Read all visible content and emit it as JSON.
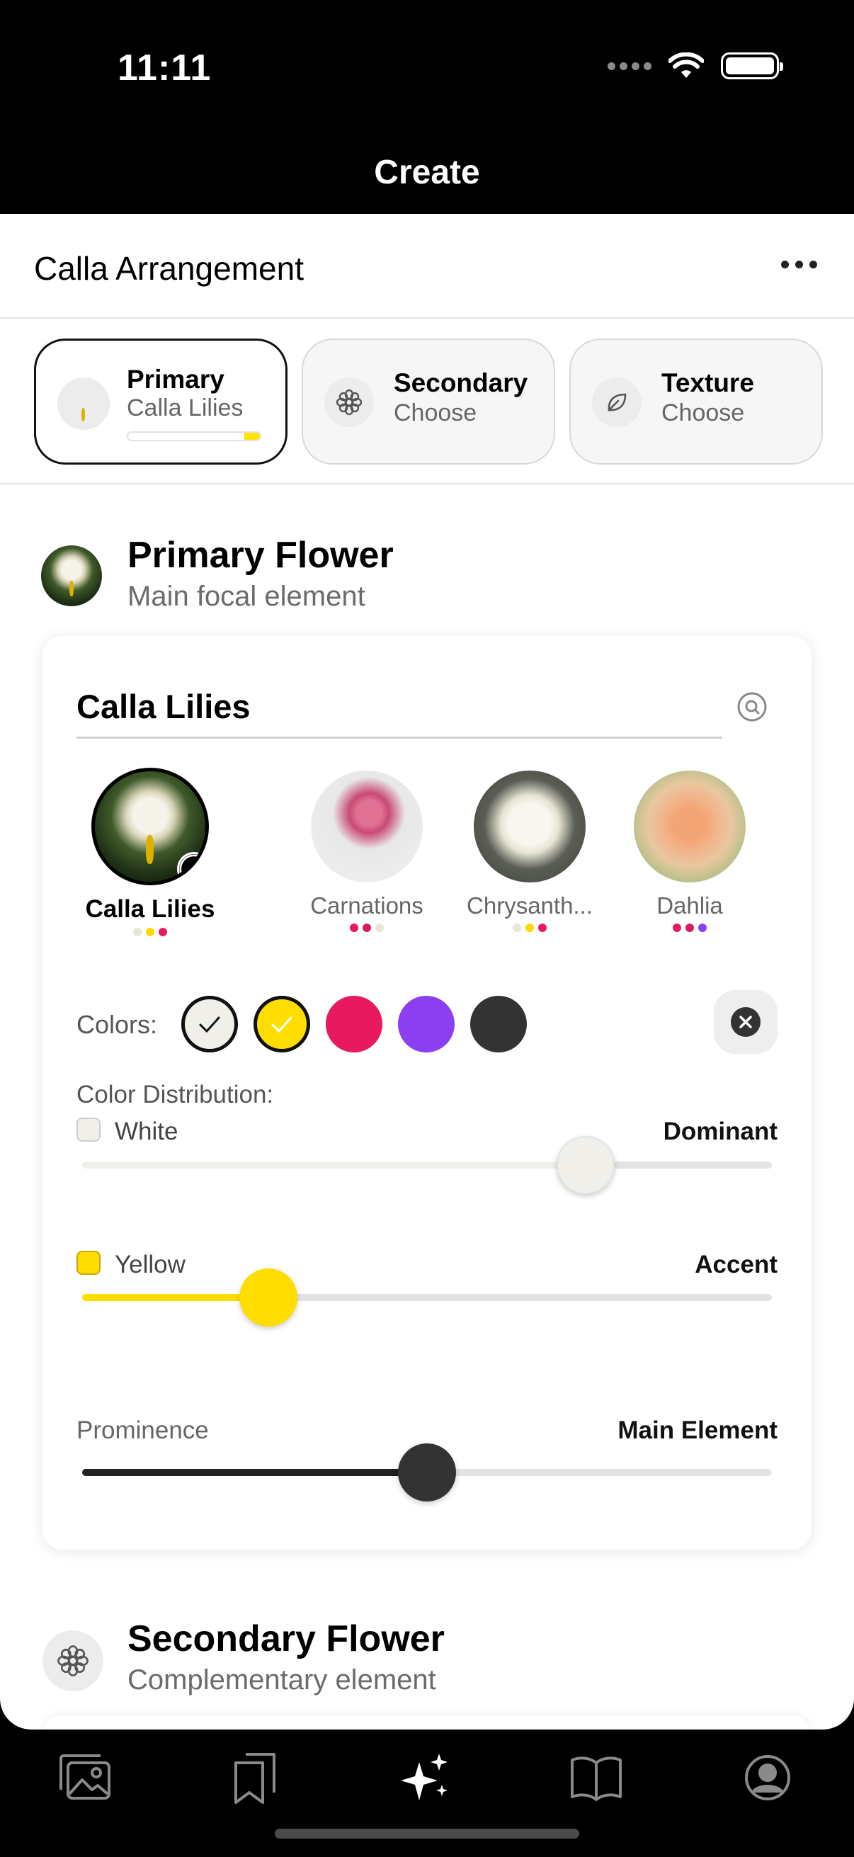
{
  "status_bar": {
    "time": "11:11"
  },
  "nav": {
    "title": "Create"
  },
  "arrangement": {
    "title": "Calla Arrangement"
  },
  "tabs": [
    {
      "label": "Primary",
      "sub": "Calla Lilies",
      "progress": 0.12
    },
    {
      "label": "Secondary",
      "sub": "Choose",
      "icon": "flower-icon"
    },
    {
      "label": "Texture",
      "sub": "Choose",
      "icon": "leaf-icon"
    }
  ],
  "primary_section": {
    "title": "Primary Flower",
    "subtitle": "Main focal element",
    "search_value": "Calla Lilies",
    "flowers": [
      {
        "name": "Calla Lilies",
        "selected": true,
        "dots": [
          "#e8e6d8",
          "#ffd900",
          "#e8195f"
        ]
      },
      {
        "name": "Carnations",
        "dots": [
          "#e8195f",
          "#d81b60",
          "#e8e6d8"
        ]
      },
      {
        "name": "Chrysanth...",
        "dots": [
          "#e8e6d8",
          "#ffd900",
          "#e8195f"
        ]
      },
      {
        "name": "Dahlia",
        "dots": [
          "#e8195f",
          "#d81b60",
          "#8a3ff0"
        ]
      }
    ],
    "colors_label": "Colors:",
    "colors": [
      {
        "name": "white",
        "hex": "#f0efe9",
        "selected": true
      },
      {
        "name": "yellow",
        "hex": "#ffdd00",
        "selected": true
      },
      {
        "name": "pink",
        "hex": "#e8195f"
      },
      {
        "name": "purple",
        "hex": "#8a3ff0"
      },
      {
        "name": "charcoal",
        "hex": "#333333"
      }
    ],
    "distribution_label": "Color Distribution:",
    "distribution": [
      {
        "name": "White",
        "level": "Dominant",
        "value": 0.73,
        "color": "#f0efe9"
      },
      {
        "name": "Yellow",
        "level": "Accent",
        "value": 0.27,
        "color": "#ffdd00"
      }
    ],
    "prominence": {
      "label": "Prominence",
      "value_label": "Main Element",
      "value": 0.5
    }
  },
  "secondary_section": {
    "title": "Secondary Flower",
    "subtitle": "Complementary element"
  },
  "tabbar": [
    "gallery-icon",
    "bookmarks-icon",
    "create-sparkles-icon",
    "book-icon",
    "profile-icon"
  ]
}
